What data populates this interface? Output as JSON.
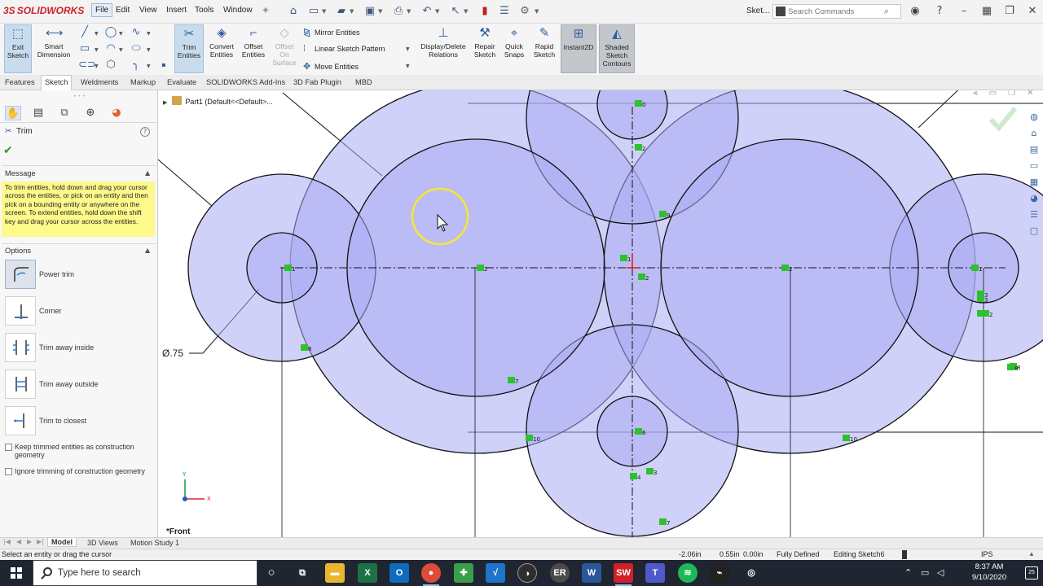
{
  "app": {
    "brand": "SOLIDWORKS",
    "document": "Sket...",
    "menus": [
      "File",
      "Edit",
      "View",
      "Insert",
      "Tools",
      "Window"
    ],
    "search_placeholder": "Search Commands"
  },
  "command_manager": {
    "big_buttons": [
      {
        "label": "Exit Sketch",
        "icon": "exit-sketch-icon"
      },
      {
        "label": "Smart Dimension",
        "icon": "smart-dimension-icon"
      },
      {
        "label": "Trim Entities",
        "icon": "trim-entities-icon",
        "selected": true
      },
      {
        "label": "Convert Entities",
        "icon": "convert-entities-icon"
      },
      {
        "label": "Offset Entities",
        "icon": "offset-entities-icon"
      },
      {
        "label": "Offset On Surface",
        "icon": "offset-on-surface-icon",
        "disabled": true
      },
      {
        "label": "Display/Delete Relations",
        "icon": "relations-icon"
      },
      {
        "label": "Repair Sketch",
        "icon": "repair-sketch-icon"
      },
      {
        "label": "Quick Snaps",
        "icon": "quick-snaps-icon"
      },
      {
        "label": "Rapid Sketch",
        "icon": "rapid-sketch-icon"
      },
      {
        "label": "Instant2D",
        "icon": "instant2d-icon",
        "toggled": true
      },
      {
        "label": "Shaded Sketch Contours",
        "icon": "shaded-sketch-contours-icon",
        "toggled": true
      }
    ],
    "small_buttons": [
      "Mirror Entities",
      "Linear Sketch Pattern",
      "Move Entities"
    ]
  },
  "tabs": [
    "Features",
    "Sketch",
    "Weldments",
    "Markup",
    "Evaluate",
    "SOLIDWORKS Add-Ins",
    "3D Fab Plugin",
    "MBD"
  ],
  "active_tab": "Sketch",
  "property_manager": {
    "title": "Trim",
    "message_header": "Message",
    "message": "To trim entities, hold down and drag your cursor across the entities, or pick on an entity and then pick on a bounding entity or anywhere on the screen. To extend entities, hold down the shift key and drag your cursor across the entities.",
    "options_header": "Options",
    "options": [
      {
        "label": "Power trim",
        "active": true
      },
      {
        "label": "Corner",
        "active": false
      },
      {
        "label": "Trim away inside",
        "active": false
      },
      {
        "label": "Trim away outside",
        "active": false
      },
      {
        "label": "Trim to closest",
        "active": false
      }
    ],
    "checkboxes": [
      {
        "label": "Keep trimmed entities as construction geometry",
        "checked": false
      },
      {
        "label": "Ignore trimming of construction geometry",
        "checked": false
      }
    ]
  },
  "graphics": {
    "feature_tree_item": "Part1  (Default<<Default>...",
    "view_name": "*Front",
    "dimension": "Ø.75",
    "colors": {
      "fill": "#a9abf2",
      "stroke": "#111111",
      "relation": "#2ec12e",
      "highlight": "#f3ea2a"
    },
    "relation_numbers": [
      "1",
      "2",
      "2",
      "1",
      "0",
      "2",
      "1",
      "2",
      "3",
      "4",
      "8",
      "7",
      "10",
      "6",
      "4",
      "3",
      "7",
      "9",
      "10",
      "8",
      "2",
      "3",
      "8"
    ]
  },
  "model_tabs": [
    "Model",
    "3D Views",
    "Motion Study 1"
  ],
  "status": {
    "hint": "Select an entity or drag the cursor",
    "x": "-2.06in",
    "y": "0.55in",
    "z": "0.00in",
    "state": "Fully Defined",
    "editing": "Editing Sketch6",
    "units": "IPS"
  },
  "taskbar": {
    "search_placeholder": "Type here to search",
    "time": "8:37 AM",
    "date": "9/10/2020",
    "notifications": "25"
  }
}
